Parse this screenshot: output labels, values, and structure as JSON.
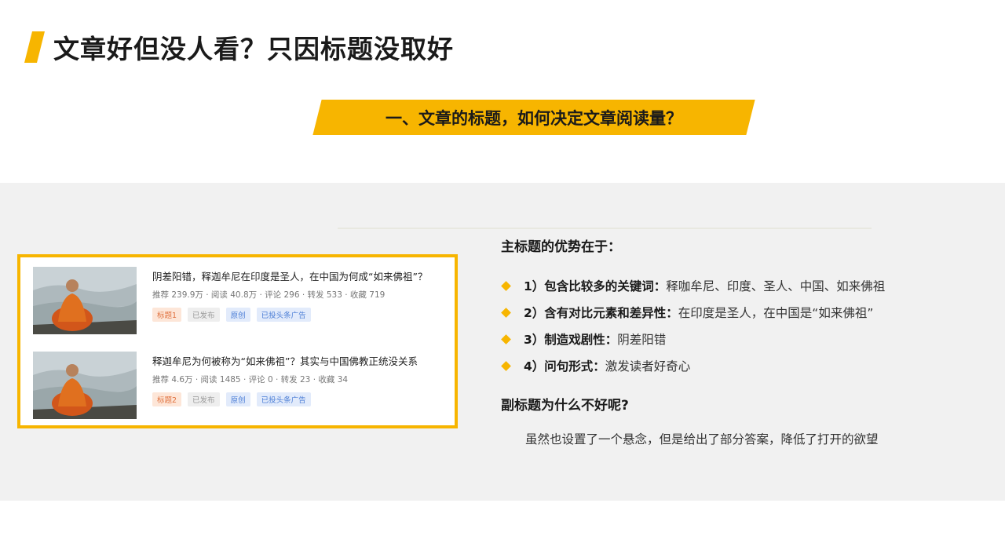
{
  "page_title": "文章好但没人看？只因标题没取好",
  "section_title": "一、文章的标题，如何决定文章阅读量？",
  "feed": {
    "items": [
      {
        "title": "阴差阳错，释迦牟尼在印度是圣人，在中国为何成“如来佛祖”？",
        "stats": "推荐 239.9万 · 阅读 40.8万 · 评论 296 · 转发 533 · 收藏 719",
        "tags": [
          "标题1",
          "已发布",
          "原创",
          "已投头条广告"
        ]
      },
      {
        "title": "释迦牟尼为何被称为“如来佛祖”？其实与中国佛教正统没关系",
        "stats": "推荐 4.6万 · 阅读 1485 · 评论 0 · 转发 23 · 收藏 34",
        "tags": [
          "标题2",
          "已发布",
          "原创",
          "已投头条广告"
        ]
      }
    ]
  },
  "points": {
    "heading": "主标题的优势在于：",
    "items": [
      {
        "label": "1）包含比较多的关键词：",
        "detail": "释咖牟尼、印度、圣人、中国、如来佛祖"
      },
      {
        "label": "2）含有对比元素和差异性：",
        "detail": "在印度是圣人，在中国是“如来佛祖”"
      },
      {
        "label": "3）制造戏剧性：",
        "detail": "阴差阳错"
      },
      {
        "label": "4）问句形式：",
        "detail": "激发读者好奇心"
      }
    ]
  },
  "subtitle_section": {
    "heading": "副标题为什么不好呢?",
    "text": "虽然也设置了一个悬念，但是给出了部分答案，降低了打开的欲望"
  },
  "colors": {
    "accent": "#f7b500",
    "panel": "#f1f1f1"
  },
  "icons": {
    "bullet": "diamond-bullet-icon",
    "thumbnail": "monk-meditating-thumbnail"
  }
}
